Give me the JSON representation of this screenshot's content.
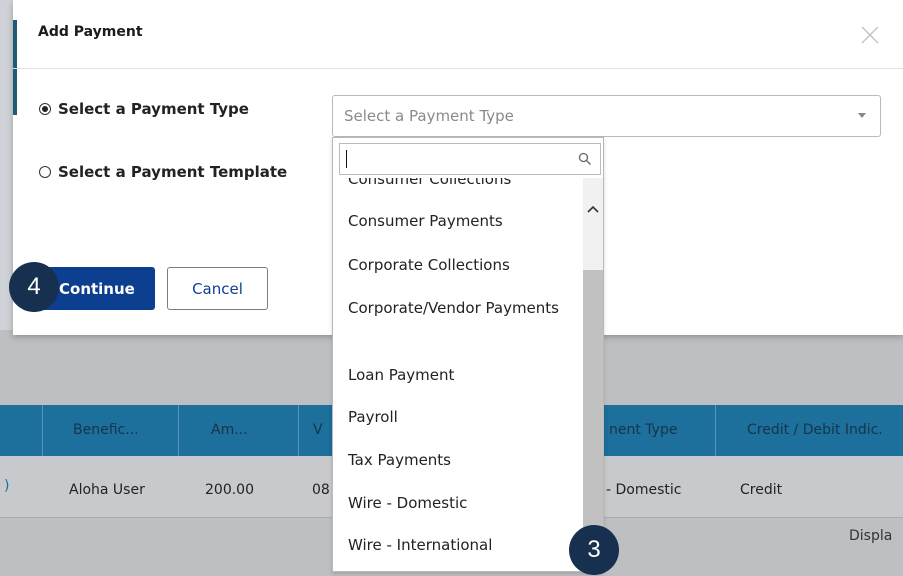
{
  "background_table": {
    "headers": [
      "Benefic...",
      "Am...",
      "V",
      "nent Type",
      "Credit / Debit Indic."
    ],
    "row": [
      "Aloha User",
      "200.00",
      "08",
      "- Domestic",
      "Credit"
    ],
    "left_fragment": ")",
    "footer_text": "Displa"
  },
  "modal": {
    "title": "Add Payment",
    "radio_payment_type": "Select a Payment Type",
    "radio_template": "Select a Payment Template",
    "select_placeholder": "Select a Payment Type",
    "continue_label": "Continue",
    "cancel_label": "Cancel"
  },
  "dropdown": {
    "partial_top_item": "Consumer Collections",
    "items": [
      "Consumer Payments",
      "Corporate Collections",
      "Corporate/Vendor Payments",
      "Loan Payment",
      "Payroll",
      "Tax Payments",
      "Wire - Domestic",
      "Wire - International"
    ]
  },
  "badges": {
    "step_continue": "4",
    "step_dropdown": "3"
  },
  "colors": {
    "primary_button": "#0c3f8f",
    "table_header": "#1d6f9c",
    "badge": "#17304f"
  }
}
